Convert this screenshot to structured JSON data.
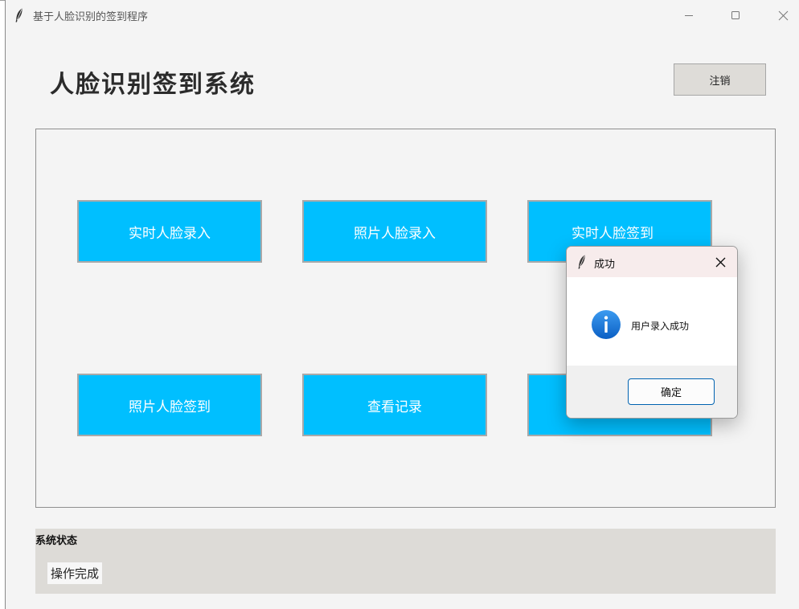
{
  "window": {
    "title": "基于人脸识别的签到程序",
    "controls": {
      "minimize_icon": "minimize-icon",
      "maximize_icon": "maximize-icon",
      "close_icon": "close-icon"
    }
  },
  "header": {
    "title": "人脸识别签到系统",
    "logout_label": "注销"
  },
  "actions": [
    {
      "label": "实时人脸录入"
    },
    {
      "label": "照片人脸录入"
    },
    {
      "label": "实时人脸签到"
    },
    {
      "label": "照片人脸签到"
    },
    {
      "label": "查看记录"
    },
    {
      "label": ""
    }
  ],
  "status": {
    "title": "系统状态",
    "value": "操作完成"
  },
  "dialog": {
    "title": "成功",
    "message": "用户录入成功",
    "ok_label": "确定",
    "icon": "info-icon"
  },
  "colors": {
    "action_button": "#00bfff",
    "window_bg": "#f4f4f4",
    "status_bg": "#dddbd7",
    "dialog_title_bg": "#f7ecec",
    "info_icon": "#1a73d9"
  }
}
